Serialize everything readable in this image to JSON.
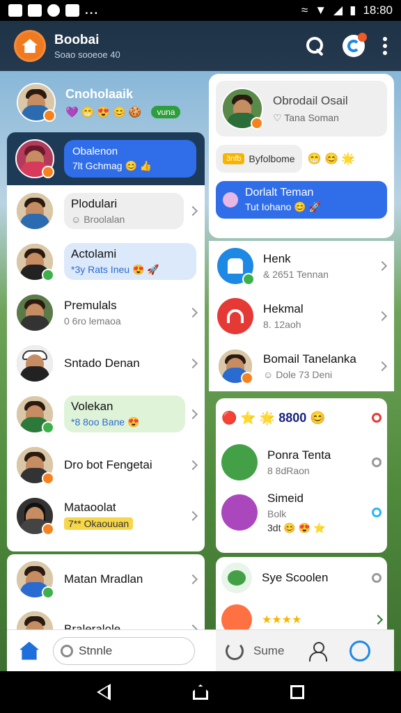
{
  "status_bar": {
    "time": "18:80",
    "left_icons": [
      "u-icon",
      "message-icon",
      "messenger-icon",
      "chat-icon"
    ],
    "overflow": "..."
  },
  "app_bar": {
    "title": "Boobai",
    "subtitle": "Soao sooeoe 40"
  },
  "left": {
    "top_contact": {
      "name": "Cnoholaaik",
      "badge": "vuna"
    },
    "selected": {
      "line1": "Obalenon",
      "line2": "7lt Gchmag"
    },
    "items": [
      {
        "name": "Plodulari",
        "sub": "Broolalan"
      },
      {
        "name": "Actolami",
        "sub": "*3y Rats Ineu"
      },
      {
        "name": "Premulals",
        "sub": "0 6ro lemaoa"
      },
      {
        "name": "Sntado Denan",
        "sub": ""
      },
      {
        "name": "Volekan",
        "sub": "*8 8oo Bane"
      },
      {
        "name": "Dro bot Fengetai",
        "sub": ""
      },
      {
        "name": "Mataoolat",
        "sub": "7** Okaouuan"
      }
    ],
    "items2": [
      {
        "name": "Matan Mradlan",
        "sub": ""
      },
      {
        "name": "Braleralole",
        "sub": ""
      }
    ]
  },
  "right": {
    "header": {
      "name": "Obrodail Osail",
      "sub": "Tana Soman"
    },
    "pill_tag": "3nfb",
    "pill_text": "Byfolbome",
    "bubble": {
      "line1": "Dorlalt Teman",
      "line2": "Tut Iohano"
    },
    "items": [
      {
        "name": "Henk",
        "sub": "& 2651 Tennan"
      },
      {
        "name": "Hekmal",
        "sub": "8. 12aoh"
      },
      {
        "name": "Bomail Tanelanka",
        "sub": "Dole 73 Deni"
      }
    ],
    "group": {
      "label": "8800"
    },
    "items2": [
      {
        "name": "Ponra Tenta",
        "sub": "8 8dRaon"
      },
      {
        "name": "Simeid",
        "sub": "Bolk",
        "extra": "3dt"
      }
    ],
    "items3": [
      {
        "name": "Sye Scoolen"
      }
    ]
  },
  "bottom_nav": {
    "search_label": "Stnnle",
    "mid_label": "Sume"
  },
  "colors": {
    "accent": "#2f6ee8",
    "app_bar": "#1f3347",
    "logo": "#f07a1f"
  }
}
